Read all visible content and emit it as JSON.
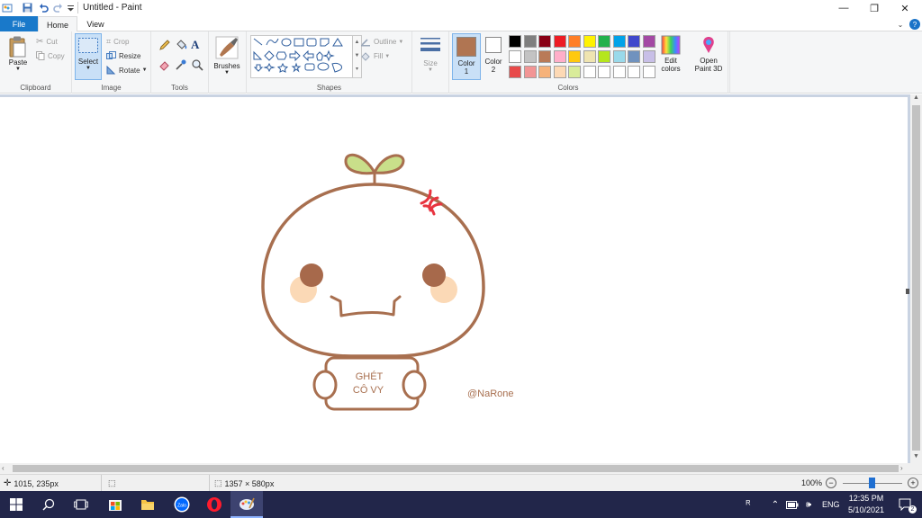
{
  "window": {
    "title": "Untitled - Paint",
    "minimize_glyph": "—",
    "restore_glyph": "❐",
    "close_glyph": "✕"
  },
  "tabs": [
    {
      "label": "File"
    },
    {
      "label": "Home"
    },
    {
      "label": "View"
    }
  ],
  "ribbon": {
    "clipboard": {
      "label": "Clipboard",
      "paste": "Paste",
      "cut": "Cut",
      "copy": "Copy"
    },
    "image": {
      "label": "Image",
      "select": "Select",
      "crop": "Crop",
      "resize": "Resize",
      "rotate": "Rotate"
    },
    "tools": {
      "label": "Tools"
    },
    "brushes": {
      "label": "Brushes"
    },
    "shapes": {
      "label": "Shapes",
      "outline": "Outline",
      "fill": "Fill"
    },
    "size": {
      "label": "Size"
    },
    "colors": {
      "label": "Colors",
      "color1_label": "Color",
      "color1_num": "1",
      "color2_label": "Color",
      "color2_num": "2",
      "color1_value": "#b07552",
      "color2_value": "#ffffff",
      "edit_colors_line1": "Edit",
      "edit_colors_line2": "colors",
      "palette_row1": [
        "#000000",
        "#7f7f7f",
        "#880015",
        "#ed1c24",
        "#ff7f27",
        "#fff200",
        "#22b14c",
        "#00a2e8",
        "#3f48cc",
        "#a349a4"
      ],
      "palette_row2": [
        "#ffffff",
        "#c3c3c3",
        "#b97a57",
        "#ffaec9",
        "#ffc90e",
        "#efe4b0",
        "#b5e61d",
        "#99d9ea",
        "#7092be",
        "#c8bfe7"
      ],
      "palette_row3": [
        "#e84a4a",
        "#f29595",
        "#f6b27a",
        "#fdd9b5",
        "#d9ec9a",
        "#ffffff",
        "#ffffff",
        "#ffffff",
        "#ffffff",
        "#ffffff"
      ]
    },
    "paint3d": {
      "line1": "Open",
      "line2": "Paint 3D"
    }
  },
  "drawing": {
    "sign_line1": "GHÉT",
    "sign_line2": "CÔ VY",
    "signature": "@NaRone",
    "outline_color": "#a86f4f",
    "leaf_color": "#c9df8a",
    "cheek_color": "#fbd9b6",
    "eye_color": "#a7694b",
    "anger_color": "#e8343f"
  },
  "statusbar": {
    "cursor_pos": "1015, 235px",
    "canvas_size": "1357 × 580px",
    "zoom": "100%"
  },
  "taskbar": {
    "lang": "ENG",
    "time": "12:35 PM",
    "date": "5/10/2021",
    "notif_count": "2"
  }
}
